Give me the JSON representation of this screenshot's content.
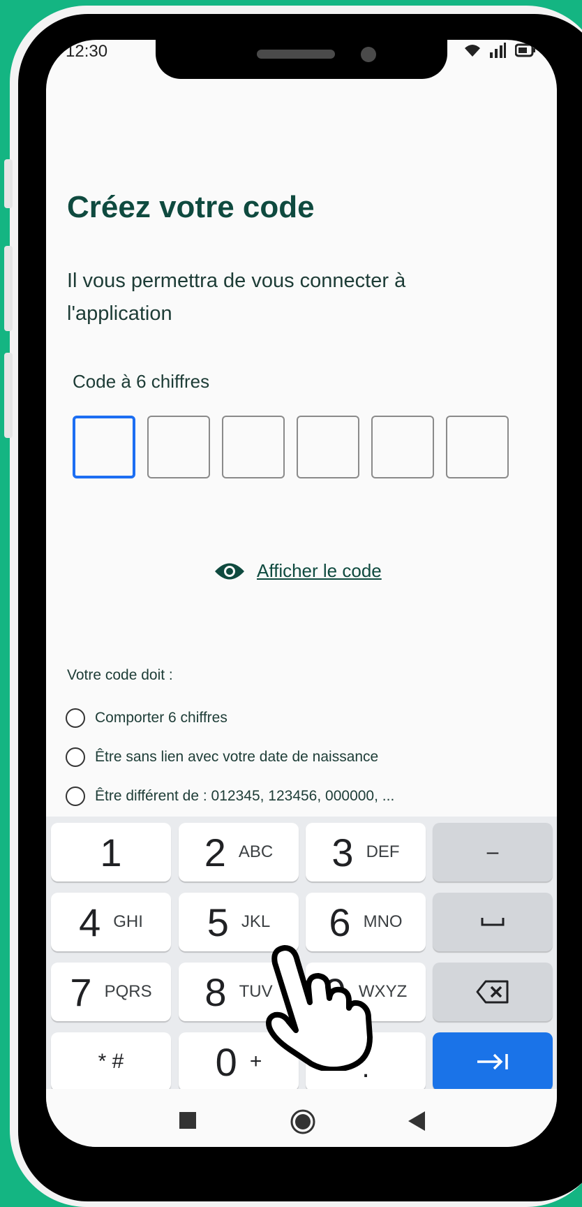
{
  "status_bar": {
    "time": "12:30"
  },
  "screen": {
    "title": "Créez votre code",
    "subtitle": "Il vous permettra de vous connecter à l'application",
    "code_label": "Code à 6 chiffres",
    "code_digits": [
      "",
      "",
      "",
      "",
      "",
      ""
    ],
    "show_code": "Afficher le code",
    "rules_title": "Votre code doit :",
    "rules": [
      "Comporter 6 chiffres",
      "Être sans lien avec votre date de naissance",
      "Être différent de : 012345, 123456, 000000, ..."
    ]
  },
  "keyboard": {
    "keys": [
      {
        "num": "1",
        "letters": ""
      },
      {
        "num": "2",
        "letters": "ABC"
      },
      {
        "num": "3",
        "letters": "DEF"
      },
      {
        "num": "4",
        "letters": "GHI"
      },
      {
        "num": "5",
        "letters": "JKL"
      },
      {
        "num": "6",
        "letters": "MNO"
      },
      {
        "num": "7",
        "letters": "PQRS"
      },
      {
        "num": "8",
        "letters": "TUV"
      },
      {
        "num": "9",
        "letters": "WXYZ"
      },
      {
        "num": "0",
        "letters": "+"
      }
    ],
    "minus": "–",
    "star_hash": "* #",
    "dot": ".",
    "space_icon": "space-icon",
    "backspace_icon": "backspace-icon",
    "next_icon": "tab-next-icon"
  },
  "colors": {
    "brand_green": "#0f4a3f",
    "background": "#14b582",
    "accent_blue": "#1a73e8"
  }
}
